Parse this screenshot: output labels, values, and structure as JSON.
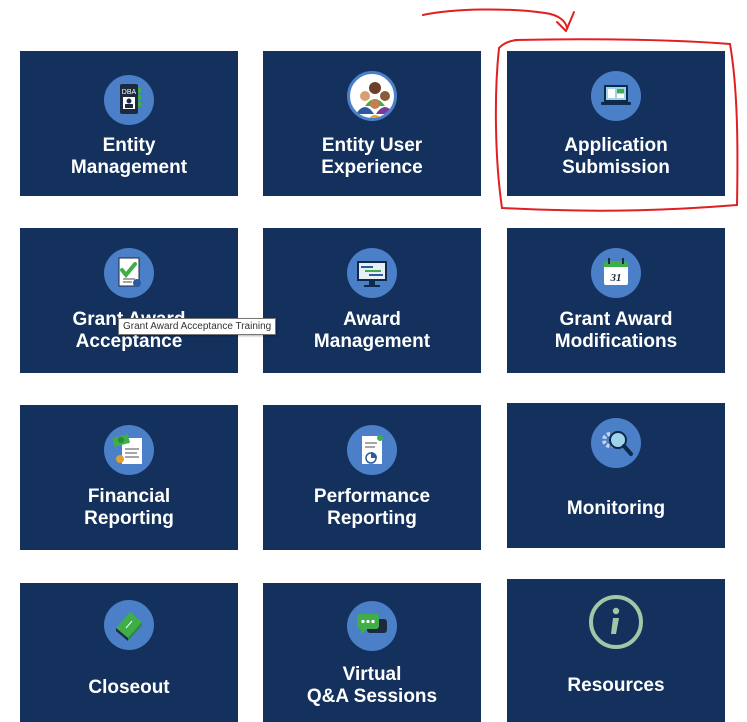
{
  "tiles": [
    {
      "id": "entity-management",
      "icon": "dba-badge-icon",
      "lines": [
        "Entity",
        "Management"
      ]
    },
    {
      "id": "entity-user-experience",
      "icon": "user-group-icon",
      "lines": [
        "Entity User",
        "Experience"
      ]
    },
    {
      "id": "application-submission",
      "icon": "laptop-document-icon",
      "lines": [
        "Application",
        "Submission"
      ]
    },
    {
      "id": "grant-award-acceptance",
      "icon": "checklist-icon",
      "lines": [
        "Grant Award",
        "Acceptance"
      ]
    },
    {
      "id": "award-management",
      "icon": "monitor-gantt-icon",
      "lines": [
        "Award",
        "Management"
      ]
    },
    {
      "id": "grant-award-modifications",
      "icon": "calendar-icon",
      "lines": [
        "Grant Award",
        "Modifications"
      ]
    },
    {
      "id": "financial-reporting",
      "icon": "money-report-icon",
      "lines": [
        "Financial",
        "Reporting"
      ]
    },
    {
      "id": "performance-reporting",
      "icon": "chart-report-icon",
      "lines": [
        "Performance",
        "Reporting"
      ]
    },
    {
      "id": "monitoring",
      "icon": "gear-magnifier-icon",
      "lines": [
        "Monitoring"
      ]
    },
    {
      "id": "closeout",
      "icon": "closed-book-icon",
      "lines": [
        "Closeout"
      ]
    },
    {
      "id": "virtual-qa-sessions",
      "icon": "chat-bubble-icon",
      "lines": [
        "Virtual",
        "Q&A Sessions"
      ]
    },
    {
      "id": "resources",
      "icon": "info-icon",
      "lines": [
        "Resources"
      ]
    }
  ],
  "tooltip": {
    "text": "Grant Award Acceptance Training"
  },
  "annotation": {
    "color": "#e02020",
    "note": "hand-drawn red arrow and outline highlighting Application Submission"
  },
  "colors": {
    "tile_bg": "#13315c",
    "icon_circle": "#4b7fc8",
    "label": "#ffffff"
  }
}
